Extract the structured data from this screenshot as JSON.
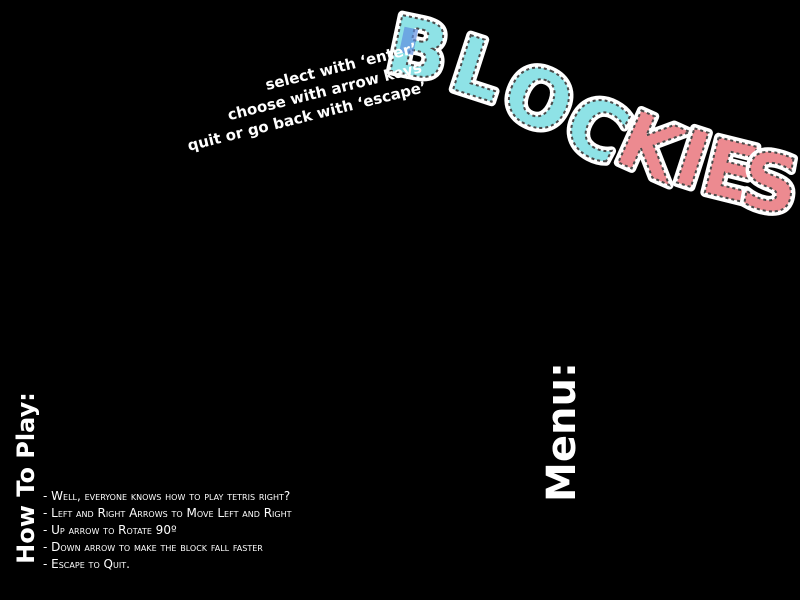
{
  "title": {
    "letters": [
      "B",
      "L",
      "O",
      "C",
      "K",
      "I",
      "E",
      "S"
    ],
    "colors": {
      "cyan": "#8ee2e6",
      "cyan_dark": "#5bc7cf",
      "pink": "#ec8a90",
      "pink_dark": "#d9666e",
      "blue_accent": "#5f8fe0",
      "outline": "#ffffff"
    }
  },
  "hints": {
    "line1": "select with ‘enter’",
    "line2": "choose with arrow keys",
    "line3": "quit or go back with ‘escape’"
  },
  "menu": {
    "heading": "Menu:"
  },
  "how_to_play": {
    "heading": "How To Play:",
    "lines": [
      "- Well, everyone knows how to play tetris right?",
      "- Left and Right Arrows to Move Left and Right",
      "- Up arrow to Rotate 90º",
      "- Down arrow to make the block fall faster",
      "- Escape to Quit."
    ]
  },
  "colors": {
    "background": "#000000",
    "text": "#ffffff"
  }
}
